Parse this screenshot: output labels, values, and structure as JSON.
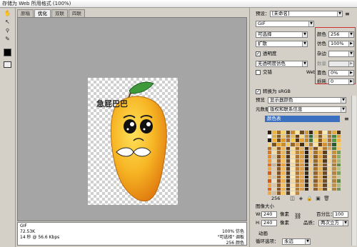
{
  "window": {
    "title": "存储为 Web 所用格式 (100%)"
  },
  "tools": [
    {
      "icon": "hand-icon",
      "glyph": "✋"
    },
    {
      "icon": "slice-select-icon",
      "glyph": "↖"
    },
    {
      "icon": "zoom-icon",
      "glyph": "🔍"
    },
    {
      "icon": "eyedropper-icon",
      "glyph": "✎"
    }
  ],
  "tabs": [
    "原稿",
    "优化",
    "双联",
    "四联"
  ],
  "active_tab": "优化",
  "canvas": {
    "image_text": "急屁巴巴",
    "info_left": [
      "GIF",
      "72.53K",
      "14 秒 @ 56.6 Kbps"
    ],
    "info_right": [
      "100% 仿色",
      "\"可选择\" 调板",
      "256 颜色"
    ]
  },
  "settings": {
    "preset_label": "预设：",
    "preset_value": "[未命名]",
    "format_value": "GIF",
    "palette_value": "可选择",
    "dither_value": "扩散",
    "transparency_label": "透明度",
    "transparency_checked": true,
    "matte_dither_value": "无透明度仿色",
    "interlaced_label": "交错",
    "interlaced_checked": false,
    "colors_label": "颜色",
    "colors_value": "256",
    "dither_pct_label": "仿色",
    "dither_pct_value": "100%",
    "matte_label": "杂边",
    "amount_label": "数量",
    "web_label": "Web",
    "websnap_label": "靠色",
    "websnap_value": "0%",
    "lossy_label": "损耗",
    "lossy_value": "0",
    "srgb_label": "转换为 sRGB",
    "srgb_checked": true,
    "preview_label": "预览",
    "preview_value": "显示器颜色",
    "metadata_label": "元数据",
    "metadata_value": "版权和联系信息"
  },
  "color_table": {
    "title": "颜色表",
    "count": "256",
    "colors": [
      "#2b1c0e",
      "#e8b73c",
      "#a0702a",
      "#f3d36a",
      "#5a3a16",
      "#c88b2f",
      "#f7e8a5",
      "#6e4a20",
      "#d69a35",
      "#3a2812",
      "#efc451",
      "#8e5e24",
      "#fbe9b8",
      "#b67c2a",
      "#e3a93e",
      "#4a3214",
      "#ffffff",
      "#d8b04a",
      "#7a5a2c",
      "#f0c870",
      "#9c6d25",
      "#e5bc5e",
      "#613f18",
      "#fad88a",
      "#c49038",
      "#2f6a3c",
      "#e6c07a",
      "#835b2b",
      "#f2d48a",
      "#ab7a33",
      "#48883c",
      "#d4a343",
      "#1a1a1a",
      "#f4b030",
      "#6b4a1f",
      "#e09a20",
      "#a5682a",
      "#f8c848",
      "#55381a",
      "#e7a532",
      "#c78423",
      "#3d7a32",
      "#f7dc6e",
      "#8d5a20",
      "#ebc050",
      "#b47028",
      "#5a9a42",
      "#f2ae3e",
      "#fbd57b",
      "#7c5420",
      "#e8a83a",
      "#c98c2a",
      "#f6c65c",
      "#98672a",
      "#dca24b",
      "#4a2e12",
      "#eec060",
      "#a87a3a",
      "#fce3a0",
      "#6a4418",
      "#d69030",
      "#b8843c",
      "#2c5a30",
      "#f4cc68",
      "#c46a1e",
      "#e8d090",
      "#8a5a2a",
      "#f2b650",
      "#5e3a14",
      "#fae0a0",
      "#a46a24",
      "#dfb468",
      "#3c2a14",
      "#eaa438",
      "#7e5226",
      "#f5d27c",
      "#b4762a",
      "#d8a656",
      "#4c7a3a",
      "#f7c05a",
      "#e07818",
      "#f0e0b0",
      "#9a6a30",
      "#e8b860",
      "#6a4820",
      "#fcd890",
      "#b88a40",
      "#dc9c3a",
      "#2e1e0e",
      "#f2c470",
      "#a4742c",
      "#e4ac4a",
      "#5c3e1a",
      "#f8d688",
      "#c8903e",
      "#7a9a5a",
      "#ee8a22",
      "#d2c4a0",
      "#7a4e24",
      "#f0b048",
      "#503414",
      "#f6e0a8",
      "#a8743a",
      "#d8a048",
      "#3a2a16",
      "#ecc26a",
      "#8c5c28",
      "#e2a442",
      "#6c4a22",
      "#fadc96",
      "#bc843a",
      "#92aa6a",
      "#f09a2a",
      "#e8d8b8",
      "#946030",
      "#f4c060",
      "#64441e",
      "#fee8b0",
      "#b07c34",
      "#e4a650",
      "#241a10",
      "#f0c878",
      "#9a6a2c",
      "#e8b048",
      "#54381c",
      "#f6d48c",
      "#c48c42",
      "#a4b47a",
      "#e86a14",
      "#c8b898",
      "#6e4420",
      "#eca440",
      "#4a3016",
      "#f4dca4",
      "#9e6c36",
      "#d89a44",
      "#443018",
      "#ead0a0",
      "#826030",
      "#dcac58",
      "#7a5430",
      "#f8e0a8",
      "#ac8040",
      "#6a8a4a",
      "#f4a440",
      "#dcccb0",
      "#885828",
      "#f2bc58",
      "#5a3c1a",
      "#fae4b0",
      "#b68038",
      "#e2a048",
      "#302012",
      "#eecc80",
      "#a07030",
      "#e6b454",
      "#604220",
      "#f4d890",
      "#c09048",
      "#b4c088",
      "#de5c10",
      "#e0d0b0",
      "#7c5026",
      "#f0b452",
      "#4e3418",
      "#f8e4b0",
      "#a87838",
      "#dea04c",
      "#3e2c18",
      "#e6cc94",
      "#926230",
      "#e0aa50",
      "#6e4c26",
      "#fcdc98",
      "#b28444",
      "#7e9c5c",
      "#f8b450",
      "#d4c4a4",
      "#905c2a",
      "#f6c868",
      "#58401c",
      "#fde8b8",
      "#b88640",
      "#e8aa52",
      "#281c10",
      "#f2d08a",
      "#9c6e34",
      "#e4b05a",
      "#5a3e1e",
      "#f0d494",
      "#c8944a",
      "#c4c898",
      "#d8580e",
      "#ece0c4",
      "#805428",
      "#eeb04c",
      "#483018",
      "#f2d8a4",
      "#a47636",
      "#da9c48",
      "#402e1a",
      "#e8cc98",
      "#8a5e2e",
      "#deaa54",
      "#765028",
      "#f6dea2",
      "#b0843e",
      "#628248",
      "#f6a848",
      "#d8c8a8",
      "#8c5c2c",
      "#f4c464",
      "#603e1a",
      "#fce0a8",
      "#b4803c",
      "#e6a64e",
      "#342414",
      "#eed088",
      "#a27232",
      "#e8b45e",
      "#664622",
      "#f2d896",
      "#c29048",
      "#acb884",
      "#e26414",
      "#e4d4b4",
      "#7e522a",
      "#f2b454",
      "#50361a",
      "#fae6b4",
      "#aa7a3a",
      "#dc9e4a",
      "#3a2a16",
      "#ead0a0",
      "#906032",
      "#e2ac56",
      "#704c28",
      "#f8e2aa",
      "#b28642",
      "#74925a",
      "#f2a644",
      "#d0c0a0",
      "#8e5e2c",
      "#f4c868",
      "#5c401e",
      "#ffeab8",
      "#ba8844"
    ]
  },
  "image_size": {
    "title": "图像大小",
    "w_label": "W:",
    "w_value": "240",
    "h_label": "H:",
    "h_value": "240",
    "unit": "像素",
    "percent_label": "百分比：",
    "percent_value": "100",
    "quality_label": "品质：",
    "quality_value": "两次立方"
  },
  "animation": {
    "title": "动画",
    "loop_label": "循环选项：",
    "loop_value": "永远"
  }
}
